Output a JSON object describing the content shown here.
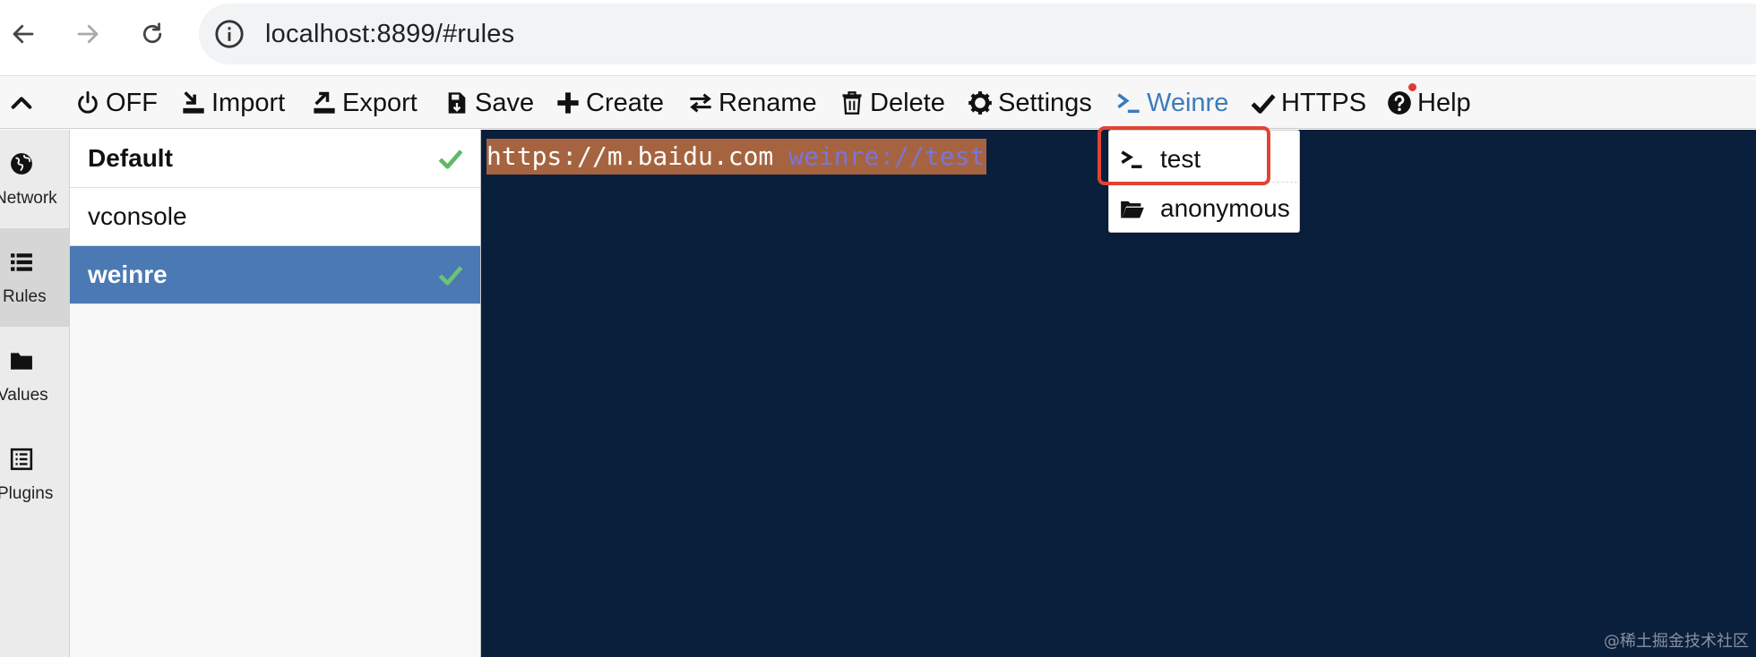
{
  "browser": {
    "url": "localhost:8899/#rules"
  },
  "toolbar": {
    "items": [
      {
        "label": "OFF",
        "icon": "power-icon"
      },
      {
        "label": "Import",
        "icon": "import-icon"
      },
      {
        "label": "Export",
        "icon": "export-icon"
      },
      {
        "label": "Save",
        "icon": "save-icon"
      },
      {
        "label": "Create",
        "icon": "plus-icon"
      },
      {
        "label": "Rename",
        "icon": "rename-icon"
      },
      {
        "label": "Delete",
        "icon": "trash-icon"
      },
      {
        "label": "Settings",
        "icon": "gear-icon"
      },
      {
        "label": "Weinre",
        "icon": "terminal-icon",
        "active": true
      },
      {
        "label": "HTTPS",
        "icon": "check-icon"
      },
      {
        "label": "Help",
        "icon": "help-icon",
        "badge": true
      }
    ],
    "active_color": "#3d7bbf"
  },
  "side_tabs": [
    {
      "label": "Network",
      "icon": "globe-icon"
    },
    {
      "label": "Rules",
      "icon": "list-icon",
      "active": true
    },
    {
      "label": "Values",
      "icon": "folder-icon"
    },
    {
      "label": "Plugins",
      "icon": "plugins-icon"
    }
  ],
  "rules": [
    {
      "name": "Default",
      "checked": true
    },
    {
      "name": "vconsole",
      "checked": false
    },
    {
      "name": "weinre",
      "checked": true,
      "selected": true
    }
  ],
  "editor": {
    "line1_url": "https://m.baidu.com ",
    "line1_protocol": "weinre://test",
    "background": "#0a1f3c"
  },
  "weinre_menu": {
    "items": [
      {
        "label": "test",
        "icon": "terminal-icon"
      },
      {
        "label": "anonymous",
        "icon": "folder-open-icon"
      }
    ]
  },
  "watermark": "@稀土掘金技术社区"
}
